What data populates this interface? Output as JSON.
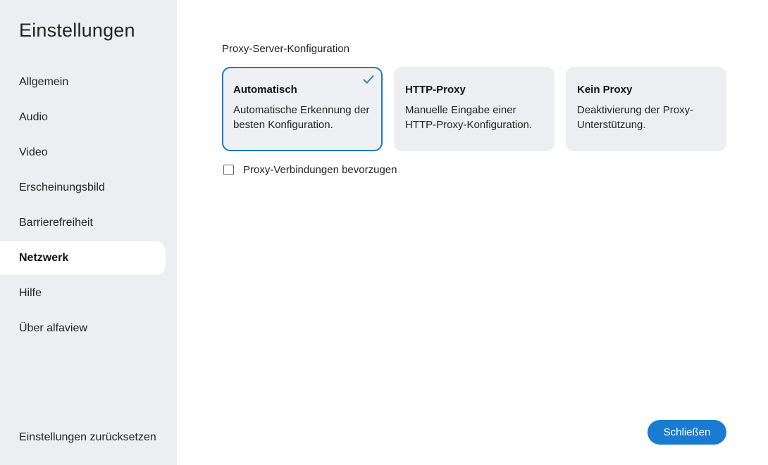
{
  "sidebar": {
    "title": "Einstellungen",
    "items": [
      {
        "label": "Allgemein",
        "active": false
      },
      {
        "label": "Audio",
        "active": false
      },
      {
        "label": "Video",
        "active": false
      },
      {
        "label": "Erscheinungsbild",
        "active": false
      },
      {
        "label": "Barrierefreiheit",
        "active": false
      },
      {
        "label": "Netzwerk",
        "active": true
      },
      {
        "label": "Hilfe",
        "active": false
      },
      {
        "label": "Über alfaview",
        "active": false
      }
    ],
    "reset_label": "Einstellungen zurücksetzen"
  },
  "main": {
    "section_label": "Proxy-Server-Konfiguration",
    "options": [
      {
        "title": "Automatisch",
        "description": "Automatische Erkennung der besten Konfiguration.",
        "selected": true
      },
      {
        "title": "HTTP-Proxy",
        "description": "Manuelle Eingabe einer HTTP-Proxy-Konfiguration.",
        "selected": false
      },
      {
        "title": "Kein Proxy",
        "description": "Deaktivierung der Proxy-Unterstützung.",
        "selected": false
      }
    ],
    "checkbox": {
      "label": "Proxy-Verbindungen bevorzugen",
      "checked": false
    },
    "close_label": "Schließen"
  },
  "colors": {
    "accent": "#1a7bd0",
    "sidebar_bg": "#eceef1",
    "card_bg": "#eceef1",
    "selected_border": "#1f78c1"
  },
  "icons": {
    "selected_marker": "check-icon"
  }
}
